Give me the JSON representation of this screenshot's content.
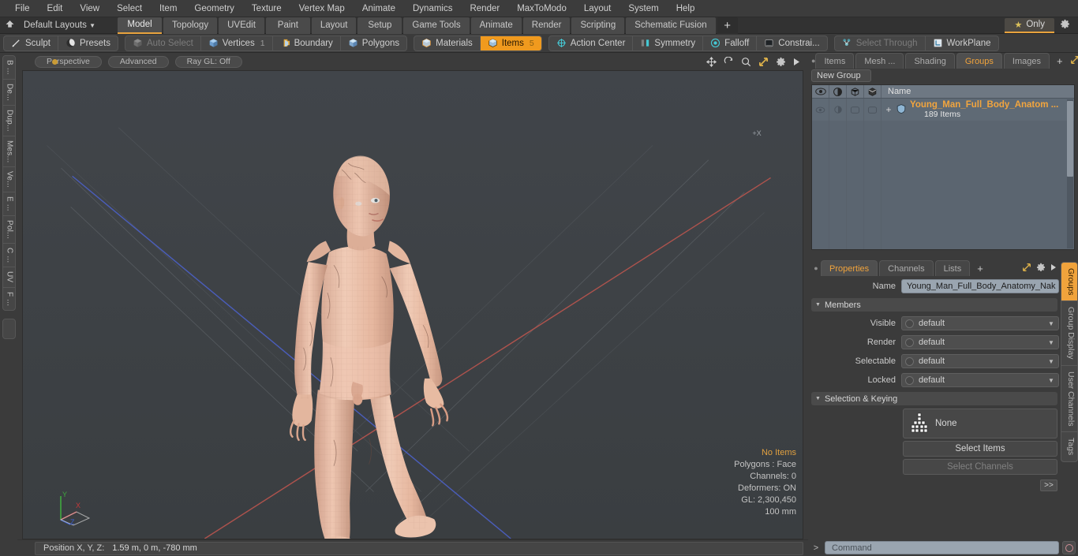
{
  "app": {
    "title": "Modo",
    "accent": "#f0a33c",
    "panel_bg": "#3b3b3b",
    "list_bg": "#5b6570"
  },
  "menubar": {
    "items": [
      {
        "label": "File"
      },
      {
        "label": "Edit"
      },
      {
        "label": "View"
      },
      {
        "label": "Select"
      },
      {
        "label": "Item"
      },
      {
        "label": "Geometry"
      },
      {
        "label": "Texture"
      },
      {
        "label": "Vertex Map"
      },
      {
        "label": "Animate"
      },
      {
        "label": "Dynamics"
      },
      {
        "label": "Render"
      },
      {
        "label": "MaxToModo"
      },
      {
        "label": "Layout"
      },
      {
        "label": "System"
      },
      {
        "label": "Help"
      }
    ]
  },
  "layoutbar": {
    "home_icon": "home-icon",
    "dropdown_label": "Default Layouts",
    "tabs": [
      {
        "label": "Model",
        "active": true
      },
      {
        "label": "Topology",
        "active": false
      },
      {
        "label": "UVEdit",
        "active": false
      },
      {
        "label": "Paint",
        "active": false
      },
      {
        "label": "Layout",
        "active": false
      },
      {
        "label": "Setup",
        "active": false
      },
      {
        "label": "Game Tools",
        "active": false
      },
      {
        "label": "Animate",
        "active": false
      },
      {
        "label": "Render",
        "active": false
      },
      {
        "label": "Scripting",
        "active": false
      },
      {
        "label": "Schematic Fusion",
        "active": false
      }
    ],
    "add_tab_label": "+",
    "only_label": "Only",
    "only_star_icon": "star-icon",
    "gear_icon": "gear-icon"
  },
  "toolbar": {
    "groups": [
      {
        "buttons": [
          {
            "label": "Sculpt",
            "icon": "brush-icon",
            "state": "normal",
            "count": ""
          },
          {
            "label": "Presets",
            "icon": "sphere-icon",
            "state": "normal",
            "count": ""
          }
        ]
      },
      {
        "buttons": [
          {
            "label": "Auto Select",
            "icon": "cube-grey-icon",
            "state": "disabled",
            "count": ""
          },
          {
            "label": "Vertices",
            "icon": "vertex-icon",
            "state": "normal",
            "count": "1"
          },
          {
            "label": "Boundary",
            "icon": "boundary-icon",
            "state": "normal",
            "count": ""
          },
          {
            "label": "Polygons",
            "icon": "polygon-icon",
            "state": "normal",
            "count": ""
          }
        ]
      },
      {
        "buttons": [
          {
            "label": "Materials",
            "icon": "material-icon",
            "state": "normal",
            "count": ""
          },
          {
            "label": "Items",
            "icon": "items-icon",
            "state": "on",
            "count": "5"
          }
        ]
      },
      {
        "buttons": [
          {
            "label": "Action Center",
            "icon": "target-icon",
            "state": "normal",
            "count": ""
          },
          {
            "label": "Symmetry",
            "icon": "symmetry-icon",
            "state": "normal",
            "count": ""
          },
          {
            "label": "Falloff",
            "icon": "falloff-icon",
            "state": "normal",
            "count": ""
          },
          {
            "label": "Constrai...",
            "icon": "constraint-icon",
            "state": "normal",
            "count": ""
          }
        ]
      },
      {
        "buttons": [
          {
            "label": "Select Through",
            "icon": "select-through-icon",
            "state": "disabled",
            "count": ""
          },
          {
            "label": "WorkPlane",
            "icon": "workplane-icon",
            "state": "normal",
            "count": ""
          }
        ]
      }
    ]
  },
  "left_tabs": {
    "items": [
      {
        "label": "B ..."
      },
      {
        "label": "De..."
      },
      {
        "label": "Dup..."
      },
      {
        "label": "Mes..."
      },
      {
        "label": "Ve..."
      },
      {
        "label": "E ..."
      },
      {
        "label": "Pol..."
      },
      {
        "label": "C ..."
      },
      {
        "label": "UV"
      },
      {
        "label": "F ..."
      }
    ]
  },
  "viewport": {
    "header": {
      "view_mode": "Perspective",
      "shading_mode": "Advanced",
      "raygl": "Ray GL: Off",
      "icons": [
        {
          "name": "move-icon"
        },
        {
          "name": "rotate-icon"
        },
        {
          "name": "zoom-icon"
        },
        {
          "name": "fit-icon"
        },
        {
          "name": "gear-icon"
        },
        {
          "name": "play-icon"
        }
      ]
    },
    "stats": {
      "selection": "No Items",
      "polygons": "Polygons : Face",
      "channels": "Channels: 0",
      "deformers": "Deformers: ON",
      "gl": "GL: 2,300,450",
      "scale": "100 mm"
    },
    "axis": {
      "x": "X",
      "y": "Y",
      "z": "Z",
      "x_color": "#c4383a",
      "y_color": "#3fa83f",
      "z_color": "#3b5fd0"
    },
    "grid": {
      "x_axis_color": "#b4544e",
      "z_axis_color": "#4b5fc0",
      "bg_color": "#3e4245"
    },
    "model": {
      "name": "Young_Man_Full_Body_Anatomy",
      "skin_color": "#e8bfa8"
    }
  },
  "statusbar": {
    "position_label": "Position X, Y, Z:",
    "position_value": "1.59 m, 0 m, -780 mm"
  },
  "right_panel": {
    "top_tabs": [
      {
        "label": "Items",
        "active": false
      },
      {
        "label": "Mesh ...",
        "active": false
      },
      {
        "label": "Shading",
        "active": false
      },
      {
        "label": "Groups",
        "active": true
      },
      {
        "label": "Images",
        "active": false
      }
    ],
    "top_tabs_add": "+",
    "top_tab_icons": [
      {
        "name": "expand-icon"
      },
      {
        "name": "chevron-right-icon"
      }
    ],
    "new_group_label": "New Group",
    "group_list": {
      "columns": [
        {
          "name": "eye-icon"
        },
        {
          "name": "shading-icon"
        },
        {
          "name": "wireframe-icon"
        },
        {
          "name": "selection-icon"
        }
      ],
      "name_header": "Name",
      "rows": [
        {
          "title": "Young_Man_Full_Body_Anatom ...",
          "subtitle": "189 Items",
          "icon": "group-shield-icon",
          "expand": "+"
        }
      ]
    },
    "properties": {
      "tabs": [
        {
          "label": "Properties",
          "active": true
        },
        {
          "label": "Channels",
          "active": false
        },
        {
          "label": "Lists",
          "active": false
        }
      ],
      "tabs_add": "+",
      "tab_icons": [
        {
          "name": "expand-icon"
        },
        {
          "name": "gear-icon"
        },
        {
          "name": "chevron-right-icon"
        }
      ],
      "name_label": "Name",
      "name_value": "Young_Man_Full_Body_Anatomy_Nak",
      "members_section": "Members",
      "fields": [
        {
          "label": "Visible",
          "value": "default"
        },
        {
          "label": "Render",
          "value": "default"
        },
        {
          "label": "Selectable",
          "value": "default"
        },
        {
          "label": "Locked",
          "value": "default"
        }
      ],
      "selection_section": "Selection & Keying",
      "selection_set": "None",
      "selection_set_icon": "selection-grid-icon",
      "select_items_label": "Select Items",
      "select_channels_label": "Select Channels",
      "more_label": ">>"
    },
    "side_tabs": [
      {
        "label": "Groups",
        "active": true
      },
      {
        "label": "Group Display",
        "active": false
      },
      {
        "label": "User Channels",
        "active": false
      },
      {
        "label": "Tags",
        "active": false
      }
    ]
  },
  "command_bar": {
    "prompt": ">",
    "placeholder": "Command",
    "record_icon": "record-icon"
  }
}
